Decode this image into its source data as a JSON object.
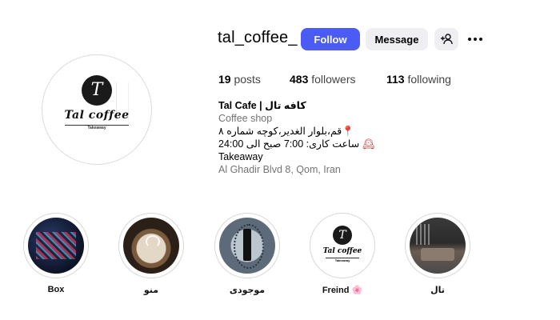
{
  "profile": {
    "username": "tal_coffee_",
    "avatar_logo": {
      "letter": "T",
      "name": "Tal coffee",
      "sub": "Takeaway"
    }
  },
  "actions": {
    "follow_label": "Follow",
    "message_label": "Message",
    "suggest_icon": "add-person-icon",
    "more_icon": "more-options-icon"
  },
  "stats": {
    "posts_count": "19",
    "posts_label": "posts",
    "followers_count": "483",
    "followers_label": "followers",
    "following_count": "113",
    "following_label": "following"
  },
  "bio": {
    "title": "Tal Cafe | کافه تال",
    "category": "Coffee shop",
    "address_fa": "قم،بلوار الغدیر،کوچه شماره ۸",
    "pin_emoji": "📍",
    "hours": "ساعت کاری: 7:00 صبح الی 24:00",
    "clock_emoji": "🕰",
    "takeaway": "Takeaway",
    "address_en": "Al Ghadir Blvd 8, Qom, Iran"
  },
  "highlights": [
    {
      "label": "Box"
    },
    {
      "label": "منو"
    },
    {
      "label": "موجودی"
    },
    {
      "label": "Freind 🌸",
      "logo_letter": "T",
      "logo_name": "Tal coffee",
      "logo_sub": "Takeaway"
    },
    {
      "label": "تال"
    }
  ],
  "colors": {
    "follow_button": "#4b5cf6",
    "secondary_button": "#efeff3",
    "muted_text": "#737373"
  }
}
